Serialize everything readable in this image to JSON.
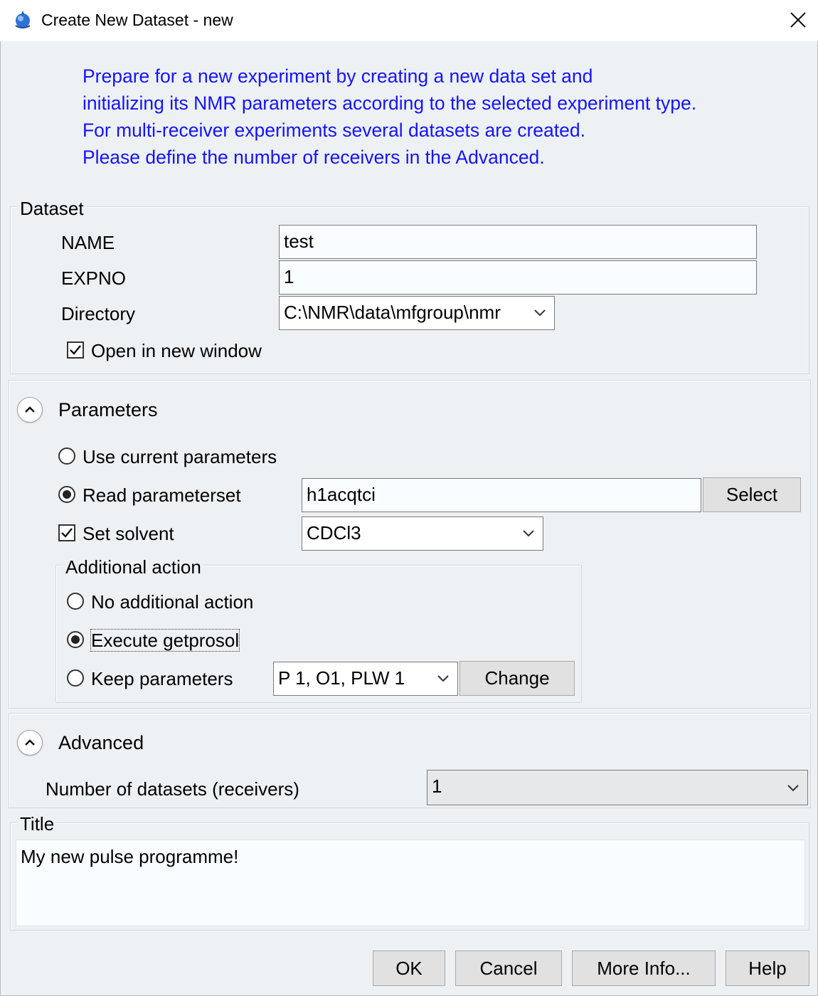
{
  "window": {
    "title": "Create New Dataset - new",
    "icon": "topspin-app-icon",
    "close_icon": "close-icon"
  },
  "intro": {
    "lines": [
      "Prepare for a new experiment by creating a new data set and",
      "initializing its NMR parameters according to the selected experiment type.",
      "For multi-receiver experiments several datasets are created.",
      "Please define the number of receivers in the Advanced."
    ],
    "color": "#1414ff"
  },
  "dataset": {
    "legend": "Dataset",
    "name_label": "NAME",
    "name_value": "test",
    "expno_label": "EXPNO",
    "expno_value": "1",
    "directory_label": "Directory",
    "directory_value": "C:\\NMR\\data\\mfgroup\\nmr",
    "open_new_window_label": "Open in new window",
    "open_new_window_checked": true
  },
  "parameters": {
    "title": "Parameters",
    "expanded": true,
    "use_current_label": "Use current parameters",
    "read_paramset_label": "Read parameterset",
    "selected_mode": "read_paramset",
    "paramset_value": "h1acqtci",
    "select_button": "Select",
    "set_solvent_label": "Set solvent",
    "set_solvent_checked": true,
    "solvent_value": "CDCl3",
    "additional_action": {
      "legend": "Additional action",
      "no_action_label": "No additional action",
      "execute_label": "Execute getprosol",
      "keep_label": "Keep parameters",
      "selected": "execute",
      "keep_value": "P 1, O1, PLW 1",
      "change_button": "Change"
    }
  },
  "advanced": {
    "title": "Advanced",
    "expanded": true,
    "receivers_label": "Number of datasets (receivers)",
    "receivers_value": "1"
  },
  "title_section": {
    "legend": "Title",
    "value": "My new pulse programme!"
  },
  "buttons": {
    "ok": "OK",
    "cancel": "Cancel",
    "more_info": "More Info...",
    "help": "Help"
  }
}
